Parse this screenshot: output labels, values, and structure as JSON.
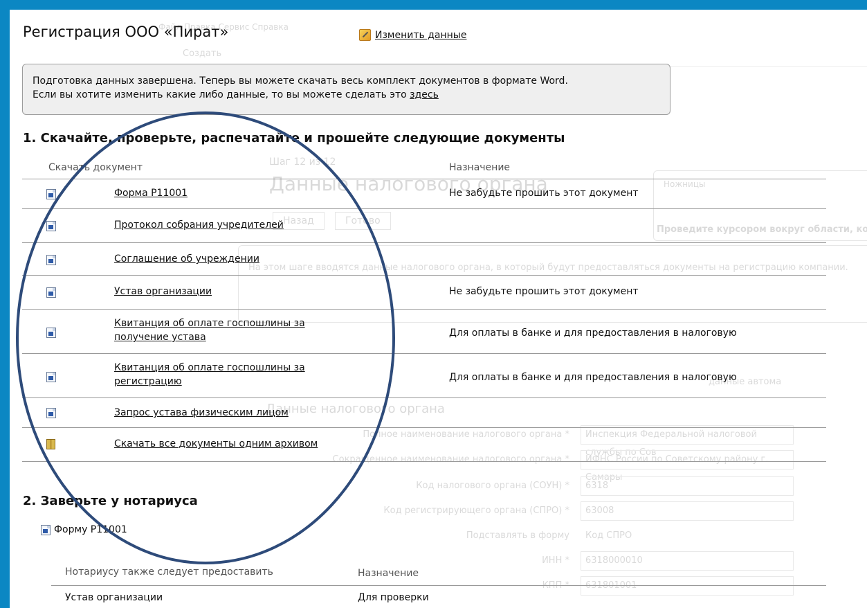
{
  "header": {
    "title": "Регистрация ООО «Пират»",
    "edit_link": "Изменить данные"
  },
  "notice": {
    "line1": "Подготовка данных завершена. Теперь вы можете скачать весь комплект документов в формате Word.",
    "line2_prefix": "Если вы хотите изменить какие либо данные, то вы можете сделать это ",
    "line2_link": "здесь"
  },
  "section1": {
    "title": "1. Скачайте, проверьте, распечатайте и прошейте следующие документы",
    "col_download": "Скачать документ",
    "col_purpose": "Назначение",
    "rows": [
      {
        "icon": "word-doc-icon",
        "name": "Форма Р11001",
        "purpose": "Не забудьте прошить этот документ"
      },
      {
        "icon": "word-doc-icon",
        "name": "Протокол собрания учредителей",
        "purpose": ""
      },
      {
        "icon": "word-doc-icon",
        "name": "Соглашение об учреждении",
        "purpose": ""
      },
      {
        "icon": "word-doc-icon",
        "name": "Устав организации",
        "purpose": "Не забудьте прошить этот документ"
      },
      {
        "icon": "word-doc-icon",
        "name": "Квитанция об оплате госпошлины за получение устава",
        "purpose": "Для оплаты в банке и для предоставления в налоговую"
      },
      {
        "icon": "word-doc-icon",
        "name": "Квитанция об оплате госпошлины за регистрацию",
        "purpose": "Для оплаты в банке и для предоставления в налоговую"
      },
      {
        "icon": "word-doc-icon",
        "name": "Запрос устава физическим лицом",
        "purpose": ""
      },
      {
        "icon": "archive-icon",
        "name": "Скачать все документы одним архивом",
        "purpose": ""
      }
    ]
  },
  "section2": {
    "title": "2. Заверьте у нотариуса",
    "form": "Форму Р11001",
    "col_provide": "Нотариусу также следует предоставить",
    "col_purpose": "Назначение",
    "row_doc": "Устав организации",
    "row_purpose": "Для проверки"
  },
  "background": {
    "menu": "Файл  Правка  Сервис  Справка",
    "toolbar_create": "Создать",
    "step": "Шаг 12 из 12",
    "heading": "Данные налогового органа",
    "back": "Назад",
    "done": "Готово",
    "snip_title": "Ножницы",
    "snip_hint": "Проведите курсором вокруг области, которую нужно записать.",
    "para": "На этом шаге вводятся данные налогового органа, в который будут предоставляться документы на регистрацию компании.",
    "subheading": "Данные налогового органа",
    "f1_label": "Полное наименование налогового органа *",
    "f1_value": "Инспекция Федеральной налоговой службы по Сов",
    "f2_label": "Сокращенное наименование налогового органа *",
    "f2_value": "ИФНС России по Советскому району г. Самары",
    "f3_label": "Код налогового органа (СОУН) *",
    "f3_value": "6318",
    "f4_label": "Код регистрирующего органа (СПРО) *",
    "f4_value": "63008",
    "f5_label": "Подставлять в форму",
    "f5_value": "Код СПРО",
    "f6_label": "ИНН *",
    "f6_value": "6318000010",
    "f7_label": "КПП *",
    "f7_value": "631801001",
    "auto_link": "данные автома"
  }
}
